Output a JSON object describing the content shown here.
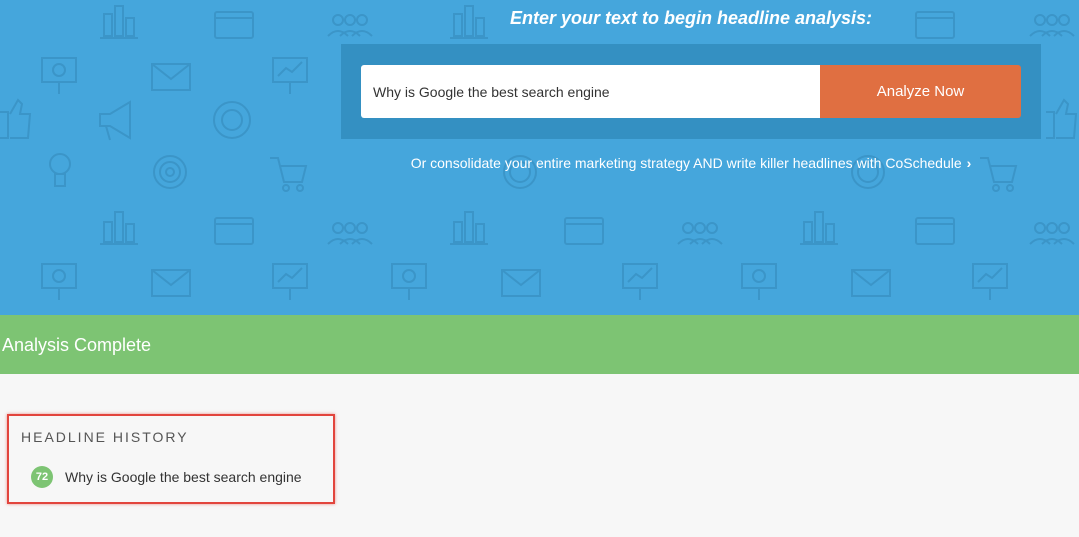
{
  "hero": {
    "title": "Enter your text to begin headline analysis:",
    "input_value": "Why is Google the best search engine",
    "analyze_label": "Analyze Now",
    "consolidate_text": "Or consolidate your entire marketing strategy AND write killer headlines with CoSchedule",
    "consolidate_icon": "chevron-right-icon",
    "background_icons": [
      "bar-chart-icon",
      "code-window-icon",
      "users-icon",
      "presentation-icon",
      "envelope-icon",
      "megaphone-icon",
      "target-icon",
      "cart-icon",
      "lightbulb-icon",
      "thumbs-up-icon",
      "pie-chart-icon"
    ]
  },
  "status": {
    "text": "Analysis Complete"
  },
  "history": {
    "heading": "HEADLINE HISTORY",
    "items": [
      {
        "score": "72",
        "text": "Why is Google the best search engine"
      }
    ]
  },
  "colors": {
    "hero_bg": "#45a6dc",
    "input_frame": "#3490c2",
    "analyze_button": "#e06f41",
    "status_bar": "#7dc473",
    "score_badge": "#7dc473",
    "highlight_border": "#e2453d"
  }
}
